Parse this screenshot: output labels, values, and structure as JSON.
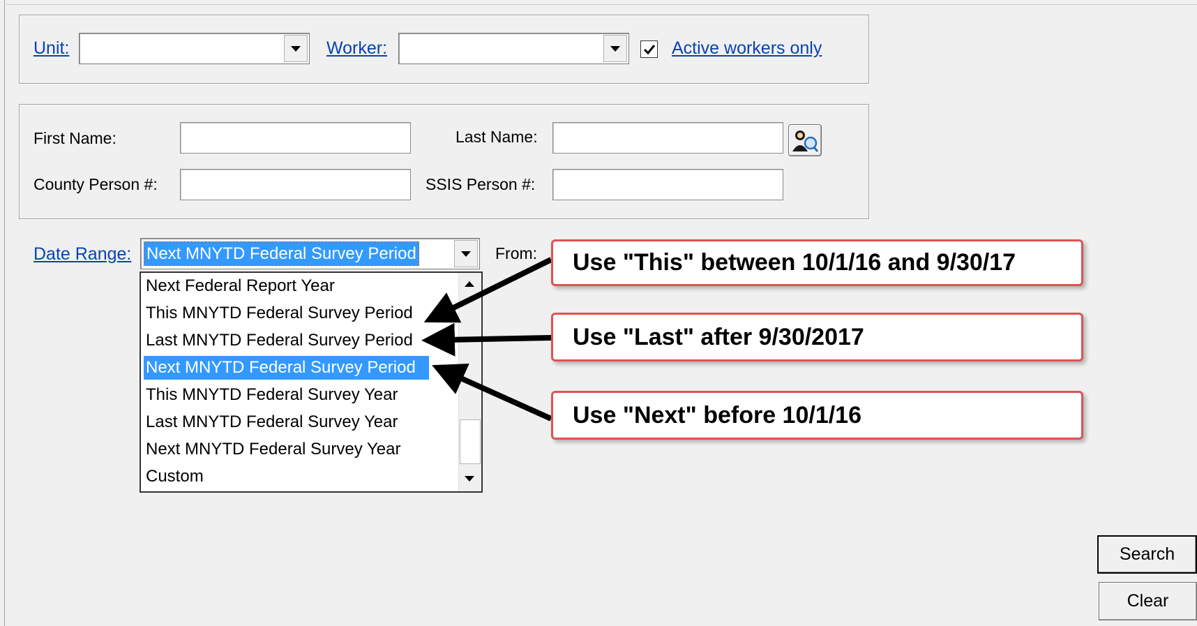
{
  "filters": {
    "unit_label": "Unit:",
    "unit_value": "",
    "worker_label": "Worker:",
    "worker_value": "",
    "active_workers_checked": true,
    "active_workers_label": "Active workers only"
  },
  "person": {
    "first_name_label": "First Name:",
    "first_name_value": "",
    "last_name_label": "Last Name:",
    "last_name_value": "",
    "county_person_label": "County Person #:",
    "county_person_value": "",
    "ssis_person_label": "SSIS Person #:",
    "ssis_person_value": "",
    "lookup_icon": "person-search-icon"
  },
  "date_range": {
    "label": "Date Range:",
    "selected": "Next MNYTD Federal Survey Period",
    "from_label": "From:",
    "options": [
      "Next Federal Report Year",
      "This MNYTD Federal Survey Period",
      "Last MNYTD Federal Survey Period",
      "Next MNYTD Federal Survey Period",
      "This MNYTD Federal Survey Year",
      "Last MNYTD Federal Survey Year",
      "Next MNYTD Federal Survey Year",
      "Custom"
    ],
    "selected_index": 3
  },
  "callouts": [
    "Use \"This\" between 10/1/16 and 9/30/17",
    "Use \"Last\" after 9/30/2017",
    "Use \"Next\" before 10/1/16"
  ],
  "buttons": {
    "search": "Search",
    "clear": "Clear"
  },
  "colors": {
    "selection": "#3399ff",
    "link": "#0645ad",
    "callout_border": "#e05252",
    "window_bg": "#f0f0f0"
  }
}
